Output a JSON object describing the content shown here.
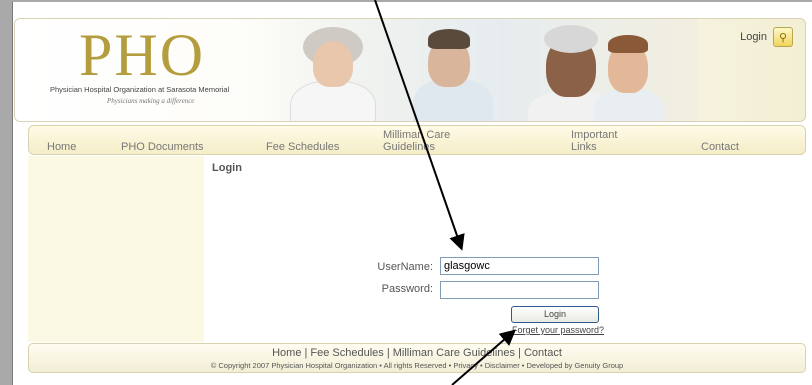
{
  "header": {
    "logo_mark": "PHO",
    "logo_org": "Physician Hospital Organization at Sarasota Memorial",
    "logo_tagline": "Physicians making a difference",
    "login_label": "Login",
    "key_icon": "key-icon"
  },
  "nav": {
    "items": [
      {
        "label": "Home"
      },
      {
        "label": "PHO Documents"
      },
      {
        "label": "Fee Schedules"
      },
      {
        "label": "Milliman Care Guidelines"
      },
      {
        "label": "Important Links"
      },
      {
        "label": "Contact"
      }
    ]
  },
  "content": {
    "title": "Login",
    "username_label": "UserName:",
    "username_value": "glasgowc",
    "password_label": "Password:",
    "password_value": "",
    "login_button": "Login",
    "forgot_link": "Forget your password?"
  },
  "footer": {
    "links": "Home | Fee Schedules | Milliman Care Guidelines | Contact",
    "copyright": "© Copyright 2007 Physician Hospital Organization • All rights Reserved • Privacy • Disclaimer • Developed by Genuity Group"
  },
  "colors": {
    "brand_gold": "#b49d3e",
    "nav_background": "#f4edc8",
    "sidebar_background": "#fbf9e4",
    "input_border": "#7f9db9"
  }
}
